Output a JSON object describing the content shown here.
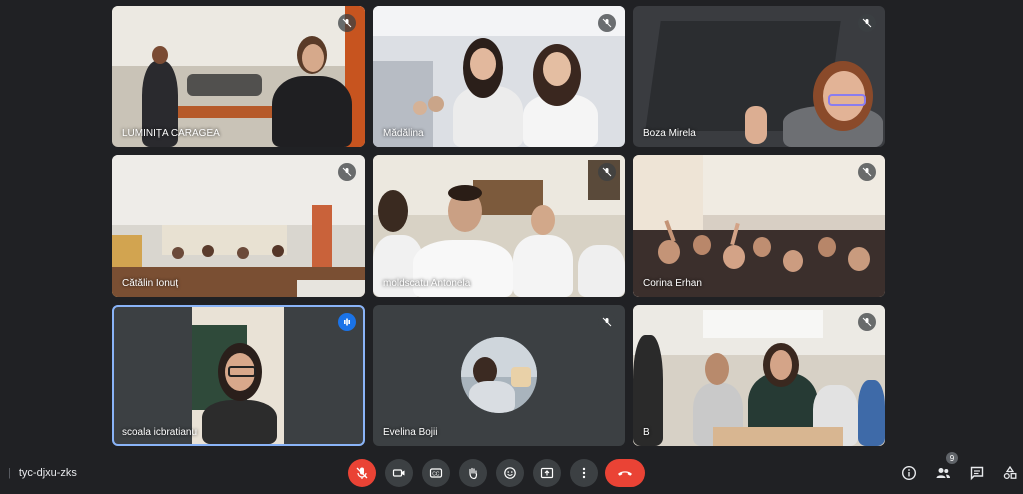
{
  "participants": [
    {
      "name": "LUMINIȚA CARAGEA",
      "muted": true
    },
    {
      "name": "Mădălina",
      "muted": true
    },
    {
      "name": "Boza Mirela",
      "muted": true
    },
    {
      "name": "Cătălin Ionuț",
      "muted": true
    },
    {
      "name": "moldscatu Antonela",
      "muted": true
    },
    {
      "name": "Corina Erhan",
      "muted": true
    },
    {
      "name": "scoala icbratianu",
      "speaking": true
    },
    {
      "name": "Evelina Bojii",
      "muted": true
    },
    {
      "name": "B",
      "muted": true
    }
  ],
  "meeting": {
    "code": "tyc-djxu-zks"
  },
  "controls": {
    "mic": "mic-off-icon",
    "camera": "camera-icon",
    "captions": "captions-icon",
    "raise_hand": "hand-icon",
    "reactions": "emoji-icon",
    "present": "present-icon",
    "more": "more-vert-icon",
    "leave": "phone-hangup-icon"
  },
  "side": {
    "people_count": "9"
  },
  "colors": {
    "background": "#202124",
    "tile": "#3c4043",
    "accent": "#8ab4f8",
    "danger": "#ea4335"
  }
}
